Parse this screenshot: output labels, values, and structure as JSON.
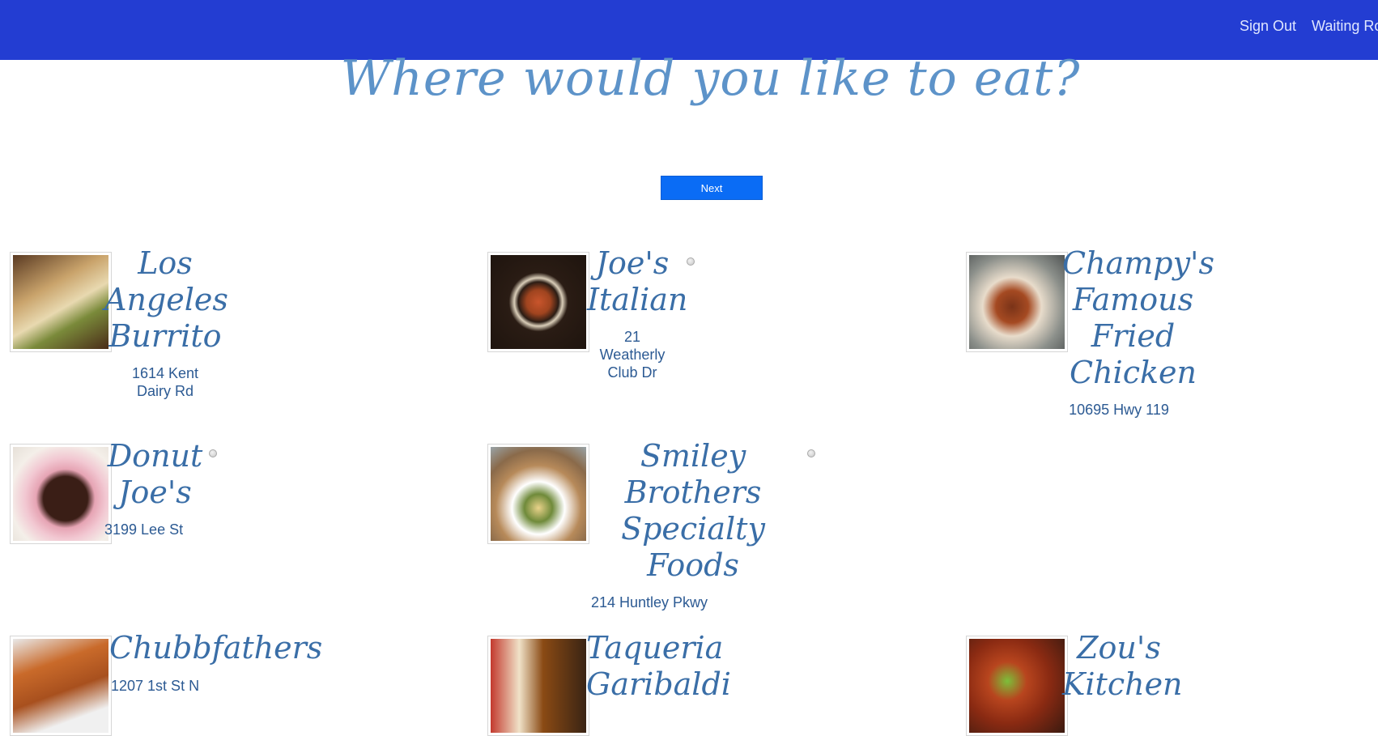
{
  "header": {
    "nav": [
      {
        "label": "Sign Out"
      },
      {
        "label": "Waiting Ro"
      }
    ]
  },
  "page": {
    "title": "Where would you like to eat?",
    "next_label": "Next"
  },
  "restaurants": [
    {
      "name": "Los Angeles Burrito",
      "address": "1614 Kent Dairy Rd"
    },
    {
      "name": "Joe's Italian",
      "address": "21 Weatherly Club Dr"
    },
    {
      "name": "Champy's Famous Fried Chicken",
      "address": "10695 Hwy 119"
    },
    {
      "name": "Donut Joe's",
      "address": "3199 Lee St"
    },
    {
      "name": "Smiley Brothers Specialty Foods",
      "address": "214 Huntley Pkwy"
    },
    {
      "name": "Chubbfathers",
      "address": "1207 1st St N"
    },
    {
      "name": "Taqueria Garibaldi",
      "address": ""
    },
    {
      "name": "Zou's Kitchen",
      "address": ""
    }
  ],
  "colors": {
    "header_bg": "#233dd2",
    "title": "#5d93c9",
    "restaurant_name": "#3a6ea7",
    "address": "#2c5a93",
    "next_button": "#0a6cf5"
  },
  "icons": {
    "select_radio": "radio-icon"
  }
}
